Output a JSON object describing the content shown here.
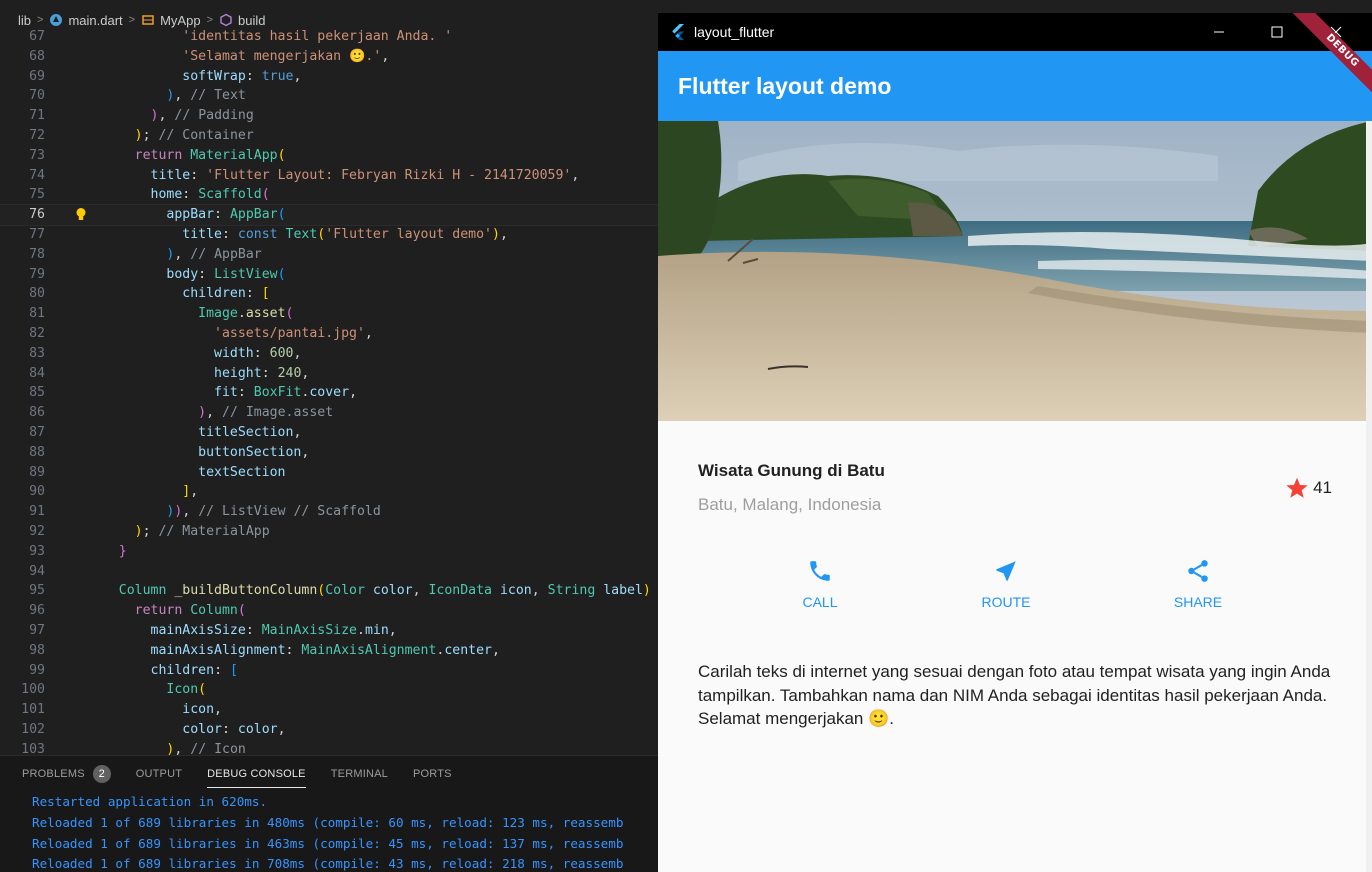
{
  "breadcrumb": [
    "lib",
    "main.dart",
    "MyApp",
    "build"
  ],
  "code_lines": [
    {
      "n": "67",
      "html": "            <span class='t-s'>'identitas hasil pekerjaan Anda. '</span>"
    },
    {
      "n": "68",
      "html": "            <span class='t-s'>'Selamat mengerjakan 🙂.'</span><span class='t-d'>,</span>"
    },
    {
      "n": "69",
      "html": "            <span class='t-p'>softWrap</span><span class='t-d'>: </span><span class='t-b'>true</span><span class='t-d'>,</span>"
    },
    {
      "n": "70",
      "html": "          <span class='t-l'>)</span><span class='t-d'>, </span><span class='t-cm'>// Text</span>"
    },
    {
      "n": "71",
      "html": "        <span class='t-v'>)</span><span class='t-d'>, </span><span class='t-cm'>// Padding</span>"
    },
    {
      "n": "72",
      "html": "      <span class='t-y'>)</span><span class='t-d'>; </span><span class='t-cm'>// Container</span>"
    },
    {
      "n": "73",
      "html": "      <span class='t-k'>return</span> <span class='t-c'>MaterialApp</span><span class='t-y'>(</span>"
    },
    {
      "n": "74",
      "html": "        <span class='t-p'>title</span><span class='t-d'>: </span><span class='t-s'>'Flutter Layout: Febryan Rizki H - 2141720059'</span><span class='t-d'>,</span>"
    },
    {
      "n": "75",
      "html": "        <span class='t-p'>home</span><span class='t-d'>: </span><span class='t-c'>Scaffold</span><span class='t-v'>(</span>"
    },
    {
      "n": "76",
      "html": "          <span class='t-p'>appBar</span><span class='t-d'>: </span><span class='t-c'>AppBar</span><span class='t-l'>(</span>",
      "current": true
    },
    {
      "n": "77",
      "html": "            <span class='t-p'>title</span><span class='t-d'>: </span><span class='t-b'>const</span> <span class='t-c'>Text</span><span class='t-y'>(</span><span class='t-s'>'Flutter layout demo'</span><span class='t-y'>)</span><span class='t-d'>,</span>"
    },
    {
      "n": "78",
      "html": "          <span class='t-l'>)</span><span class='t-d'>, </span><span class='t-cm'>// AppBar</span>"
    },
    {
      "n": "79",
      "html": "          <span class='t-p'>body</span><span class='t-d'>: </span><span class='t-c'>ListView</span><span class='t-l'>(</span>"
    },
    {
      "n": "80",
      "html": "            <span class='t-p'>children</span><span class='t-d'>: </span><span class='t-y'>[</span>"
    },
    {
      "n": "81",
      "html": "              <span class='t-c'>Image</span><span class='t-d'>.</span><span class='t-f'>asset</span><span class='t-v'>(</span>"
    },
    {
      "n": "82",
      "html": "                <span class='t-s'>'assets/pantai.jpg'</span><span class='t-d'>,</span>"
    },
    {
      "n": "83",
      "html": "                <span class='t-p'>width</span><span class='t-d'>: </span><span class='t-n'>600</span><span class='t-d'>,</span>"
    },
    {
      "n": "84",
      "html": "                <span class='t-p'>height</span><span class='t-d'>: </span><span class='t-n'>240</span><span class='t-d'>,</span>"
    },
    {
      "n": "85",
      "html": "                <span class='t-p'>fit</span><span class='t-d'>: </span><span class='t-c'>BoxFit</span><span class='t-d'>.</span><span class='t-p'>cover</span><span class='t-d'>,</span>"
    },
    {
      "n": "86",
      "html": "              <span class='t-v'>)</span><span class='t-d'>, </span><span class='t-cm'>// Image.asset</span>"
    },
    {
      "n": "87",
      "html": "              <span class='t-p'>titleSection</span><span class='t-d'>,</span>"
    },
    {
      "n": "88",
      "html": "              <span class='t-p'>buttonSection</span><span class='t-d'>,</span>"
    },
    {
      "n": "89",
      "html": "              <span class='t-p'>textSection</span>"
    },
    {
      "n": "90",
      "html": "            <span class='t-y'>]</span><span class='t-d'>,</span>"
    },
    {
      "n": "91",
      "html": "          <span class='t-l'>)</span><span class='t-v'>)</span><span class='t-d'>, </span><span class='t-cm'>// ListView // Scaffold</span>"
    },
    {
      "n": "92",
      "html": "      <span class='t-y'>)</span><span class='t-d'>; </span><span class='t-cm'>// MaterialApp</span>"
    },
    {
      "n": "93",
      "html": "    <span class='t-v'>}</span>"
    },
    {
      "n": "94",
      "html": ""
    },
    {
      "n": "95",
      "html": "    <span class='t-c'>Column</span> <span class='t-f'>_buildButtonColumn</span><span class='t-y'>(</span><span class='t-c'>Color</span> <span class='t-p'>color</span><span class='t-d'>, </span><span class='t-c'>IconData</span> <span class='t-p'>icon</span><span class='t-d'>, </span><span class='t-c'>String</span> <span class='t-p'>label</span><span class='t-y'>)</span> <span class='t-y'>{</span>"
    },
    {
      "n": "96",
      "html": "      <span class='t-k'>return</span> <span class='t-c'>Column</span><span class='t-v'>(</span>"
    },
    {
      "n": "97",
      "html": "        <span class='t-p'>mainAxisSize</span><span class='t-d'>: </span><span class='t-c'>MainAxisSize</span><span class='t-d'>.</span><span class='t-p'>min</span><span class='t-d'>,</span>"
    },
    {
      "n": "98",
      "html": "        <span class='t-p'>mainAxisAlignment</span><span class='t-d'>: </span><span class='t-c'>MainAxisAlignment</span><span class='t-d'>.</span><span class='t-p'>center</span><span class='t-d'>,</span>"
    },
    {
      "n": "99",
      "html": "        <span class='t-p'>children</span><span class='t-d'>: </span><span class='t-l'>[</span>"
    },
    {
      "n": "100",
      "html": "          <span class='t-c'>Icon</span><span class='t-y'>(</span>"
    },
    {
      "n": "101",
      "html": "            <span class='t-p'>icon</span><span class='t-d'>,</span>"
    },
    {
      "n": "102",
      "html": "            <span class='t-p'>color</span><span class='t-d'>: </span><span class='t-p'>color</span><span class='t-d'>,</span>"
    },
    {
      "n": "103",
      "html": "          <span class='t-y'>)</span><span class='t-d'>, </span><span class='t-cm'>// Icon</span>"
    }
  ],
  "panel": {
    "tabs": [
      "PROBLEMS",
      "OUTPUT",
      "DEBUG CONSOLE",
      "TERMINAL",
      "PORTS"
    ],
    "problems_count": "2",
    "active_tab": "DEBUG CONSOLE",
    "console_lines": [
      "Restarted application in 620ms.",
      "Reloaded 1 of 689 libraries in 480ms (compile: 60 ms, reload: 123 ms, reassemb",
      "Reloaded 1 of 689 libraries in 463ms (compile: 45 ms, reload: 137 ms, reassemb",
      "Reloaded 1 of 689 libraries in 708ms (compile: 43 ms, reload: 218 ms, reassemb"
    ]
  },
  "flutter_window": {
    "title": "layout_flutter",
    "appbar_title": "Flutter layout demo",
    "debug_banner": "DEBUG",
    "place_name": "Wisata Gunung di Batu",
    "place_location": "Batu, Malang, Indonesia",
    "star_count": "41",
    "actions": [
      {
        "label": "CALL",
        "icon": "phone-icon"
      },
      {
        "label": "ROUTE",
        "icon": "near-me-icon"
      },
      {
        "label": "SHARE",
        "icon": "share-icon"
      }
    ],
    "description": "Carilah teks di internet yang sesuai dengan foto atau tempat wisata yang ingin Anda tampilkan. Tambahkan nama dan NIM Anda sebagai identitas hasil pekerjaan Anda. Selamat mengerjakan 🙂."
  },
  "colors": {
    "appbar": "#2196f3",
    "accent": "#2196f3",
    "star": "#f44336",
    "console_text": "#3794ff"
  }
}
